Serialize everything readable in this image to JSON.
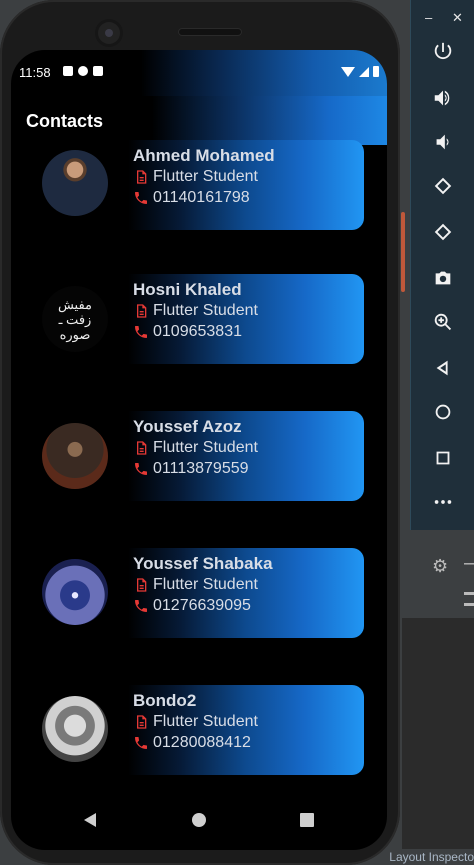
{
  "app": {
    "title": "Contacts",
    "status_time": "11:58"
  },
  "contacts": [
    {
      "name": "Ahmed Mohamed",
      "role": "Flutter Student",
      "phone": "01140161798"
    },
    {
      "name": "Hosni Khaled",
      "role": "Flutter Student",
      "phone": "0109653831",
      "avatar_text": "مفيش\nزفت ـ\nصوره"
    },
    {
      "name": "Youssef Azoz",
      "role": "Flutter Student",
      "phone": "01113879559"
    },
    {
      "name": "Youssef Shabaka",
      "role": "Flutter Student",
      "phone": "01276639095"
    },
    {
      "name": "Bondo2",
      "role": "Flutter Student",
      "phone": "01280088412"
    }
  ],
  "ide": {
    "status_text": "Layout Inspecto"
  },
  "colors": {
    "accent": "#2196f3",
    "icon_red": "#e53935",
    "background": "#000000"
  }
}
